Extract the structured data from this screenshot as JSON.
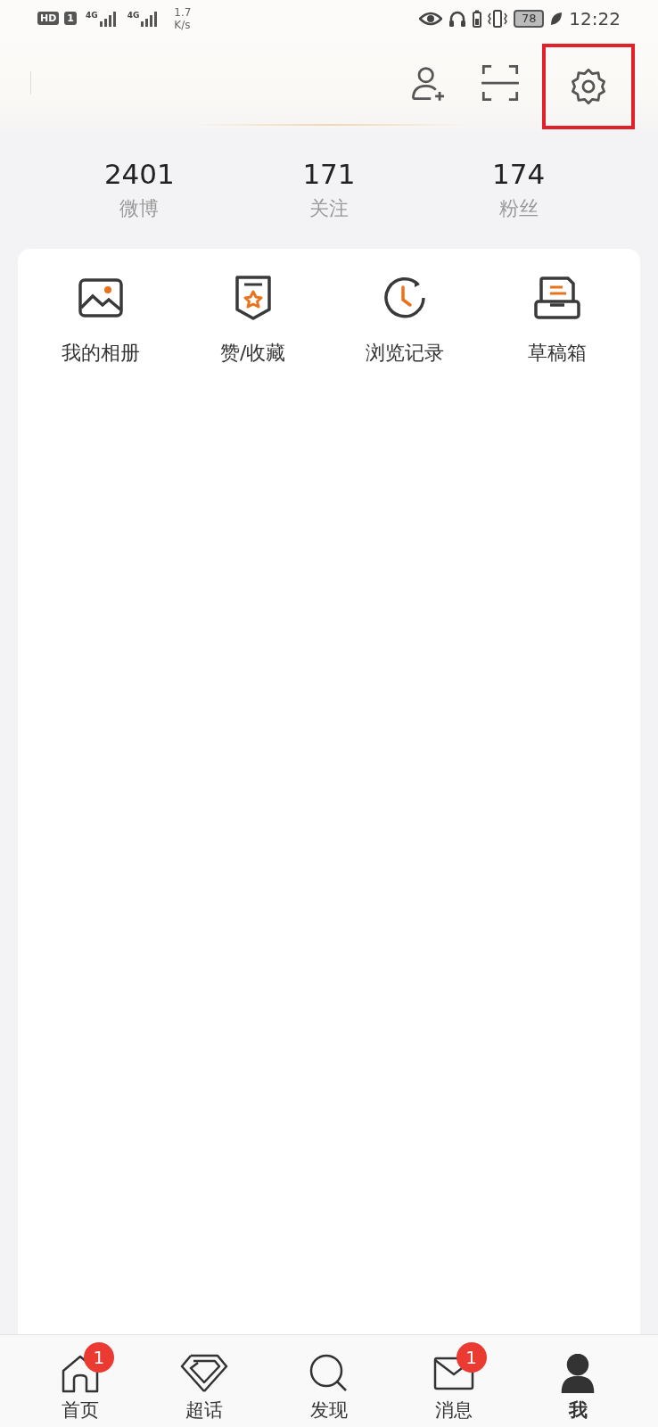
{
  "status_bar": {
    "hd": "HD",
    "sim": "1",
    "networks": [
      "4G",
      "4G"
    ],
    "speed": [
      "1.7",
      "K/s"
    ],
    "battery": "78",
    "time": "12:22"
  },
  "top_actions": [
    {
      "kind": "add-friend",
      "highlighted": false
    },
    {
      "kind": "scan",
      "highlighted": false
    },
    {
      "kind": "settings",
      "highlighted": true
    }
  ],
  "stats": [
    {
      "value": "2401",
      "label": "微博"
    },
    {
      "value": "171",
      "label": "关注"
    },
    {
      "value": "174",
      "label": "粉丝"
    }
  ],
  "shortcuts": [
    {
      "kind": "album",
      "label": "我的相册"
    },
    {
      "kind": "favorites",
      "label": "赞/收藏"
    },
    {
      "kind": "history",
      "label": "浏览记录"
    },
    {
      "kind": "drafts",
      "label": "草稿箱"
    }
  ],
  "nav": [
    {
      "kind": "home",
      "label": "首页",
      "badge": "1",
      "selected": false
    },
    {
      "kind": "topics",
      "label": "超话",
      "selected": false
    },
    {
      "kind": "discover",
      "label": "发现",
      "selected": false
    },
    {
      "kind": "messages",
      "label": "消息",
      "badge": "1",
      "selected": false
    },
    {
      "kind": "me",
      "label": "我",
      "selected": true
    }
  ]
}
